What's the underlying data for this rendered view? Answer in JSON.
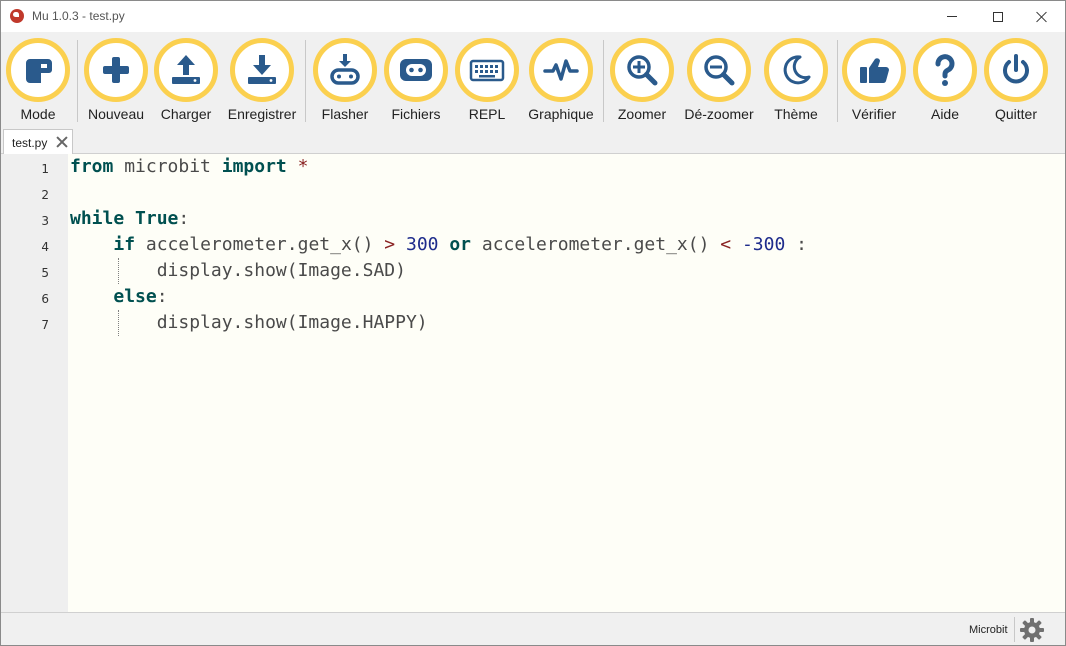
{
  "window": {
    "title": "Mu 1.0.3 - test.py"
  },
  "toolbar": {
    "buttons": [
      {
        "id": "mode",
        "label": "Mode",
        "icon": "mode-icon"
      },
      {
        "id": "new",
        "label": "Nouveau",
        "icon": "plus-icon"
      },
      {
        "id": "load",
        "label": "Charger",
        "icon": "upload-icon"
      },
      {
        "id": "save",
        "label": "Enregistrer",
        "icon": "download-icon"
      },
      {
        "id": "flash",
        "label": "Flasher",
        "icon": "flash-icon"
      },
      {
        "id": "files",
        "label": "Fichiers",
        "icon": "microbit-icon"
      },
      {
        "id": "repl",
        "label": "REPL",
        "icon": "keyboard-icon"
      },
      {
        "id": "plotter",
        "label": "Graphique",
        "icon": "pulse-icon"
      },
      {
        "id": "zoom-in",
        "label": "Zoomer",
        "icon": "zoom-in-icon"
      },
      {
        "id": "zoom-out",
        "label": "Dé-zoomer",
        "icon": "zoom-out-icon"
      },
      {
        "id": "theme",
        "label": "Thème",
        "icon": "moon-icon"
      },
      {
        "id": "check",
        "label": "Vérifier",
        "icon": "thumbs-up-icon"
      },
      {
        "id": "help",
        "label": "Aide",
        "icon": "question-icon"
      },
      {
        "id": "quit",
        "label": "Quitter",
        "icon": "power-icon"
      }
    ]
  },
  "tabs": [
    {
      "label": "test.py"
    }
  ],
  "editor": {
    "line_numbers": [
      "1",
      "2",
      "3",
      "4",
      "5",
      "6",
      "7"
    ],
    "code": {
      "line1": {
        "kw1": "from",
        "t1": " microbit ",
        "kw2": "import",
        "op1": " *"
      },
      "line3": {
        "kw1": "while",
        "t1": " ",
        "kw2": "True",
        "t2": ":"
      },
      "line4": {
        "indent": "    ",
        "kw1": "if",
        "t1": " accelerometer.get_x() ",
        "op1": ">",
        "t2": " ",
        "n1": "300",
        "t3": " ",
        "kw2": "or",
        "t4": " accelerometer.get_x() ",
        "op2": "<",
        "t5": " ",
        "n2": "-300",
        "t6": " :"
      },
      "line5": {
        "indent": "        ",
        "t1": "display.show(Image.SAD)"
      },
      "line6": {
        "indent": "    ",
        "kw1": "else",
        "t1": ":"
      },
      "line7": {
        "indent": "        ",
        "t1": "display.show(Image.HAPPY)"
      }
    }
  },
  "statusbar": {
    "mode": "Microbit",
    "settings_icon": "gear-icon"
  },
  "colors": {
    "button_ring": "#fbd04f",
    "icon": "#2a5a8c",
    "editor_bg": "#fefef7",
    "keyword": "#005050",
    "number": "#1e2c8c"
  }
}
